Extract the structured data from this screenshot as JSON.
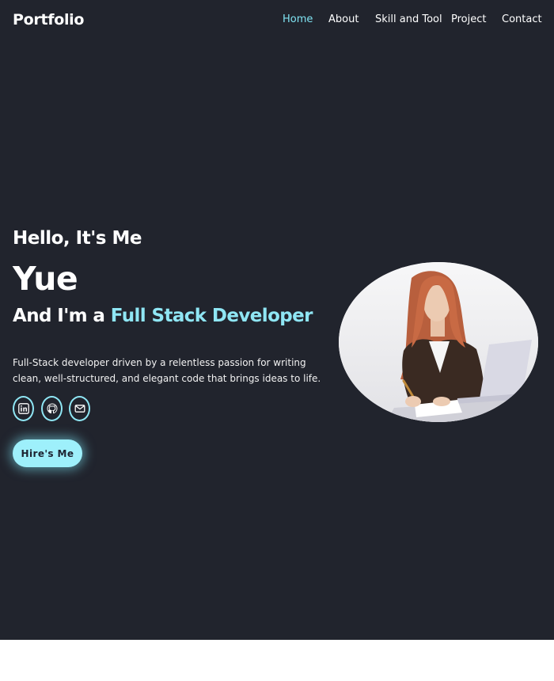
{
  "logo": "Portfolio",
  "nav": {
    "home": "Home",
    "about": "About",
    "skill": "Skill and Tool",
    "project": "Project",
    "contact": "Contact"
  },
  "hero": {
    "greeting": "Hello, It's Me",
    "name": "Yue",
    "role_prefix": "And I'm a",
    "role_highlight": "Full Stack Developer",
    "description": "Full-Stack developer driven by a relentless passion for writing clean, well-structured, and elegant code that brings ideas to life.",
    "hire_button": "Hire's Me"
  },
  "social_icons": [
    "linkedin-icon",
    "github-icon",
    "mail-icon"
  ],
  "colors": {
    "background": "#21242d",
    "accent": "#8fe6f4",
    "button": "#9ef0fb",
    "text": "#ffffff"
  }
}
